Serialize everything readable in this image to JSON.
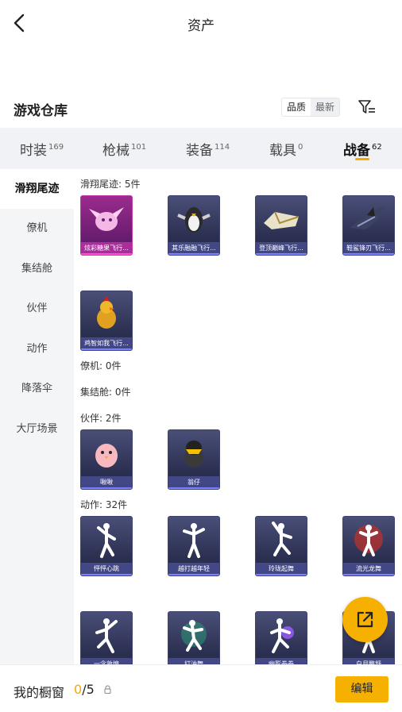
{
  "header": {
    "title": "资产"
  },
  "warehouse": {
    "title": "游戏仓库",
    "sort_options": [
      "品质",
      "最新"
    ]
  },
  "tabs": [
    {
      "label": "时装",
      "count": "169"
    },
    {
      "label": "枪械",
      "count": "101"
    },
    {
      "label": "装备",
      "count": "114"
    },
    {
      "label": "载具",
      "count": "0"
    },
    {
      "label": "战备",
      "count": "62",
      "active": true
    }
  ],
  "sidebar": {
    "items": [
      "滑翔尾迹",
      "僚机",
      "集结舱",
      "伙伴",
      "动作",
      "降落伞",
      "大厅场景"
    ]
  },
  "sections": {
    "trail": {
      "label": "滑翔尾迹: 5件",
      "items": [
        "炫彩糖果飞行...",
        "其乐融融飞行...",
        "登顶巅峰飞行...",
        "鞋鲨锋刃飞行...",
        "鸡智如我飞行..."
      ]
    },
    "wingman": {
      "label": "僚机: 0件"
    },
    "pod": {
      "label": "集结舱: 0件"
    },
    "partner": {
      "label": "伙伴: 2件",
      "items": [
        "啾啾",
        "翁仔"
      ]
    },
    "emote": {
      "label": "动作: 32件",
      "items": [
        "怦怦心跳",
        "越打越年轻",
        "玲珑起舞",
        "流光龙舞",
        "一念敦煌",
        "打油舞",
        "幽影拳拳",
        "白月鹏舒"
      ]
    }
  },
  "bottom": {
    "showcase_label": "我的橱窗",
    "showcase_current": "0",
    "showcase_total": "/5",
    "edit_label": "编辑"
  },
  "colors": {
    "accent": "#f5b000",
    "card_blue": "#2b2f50",
    "card_pink": "#9b2b8f"
  }
}
